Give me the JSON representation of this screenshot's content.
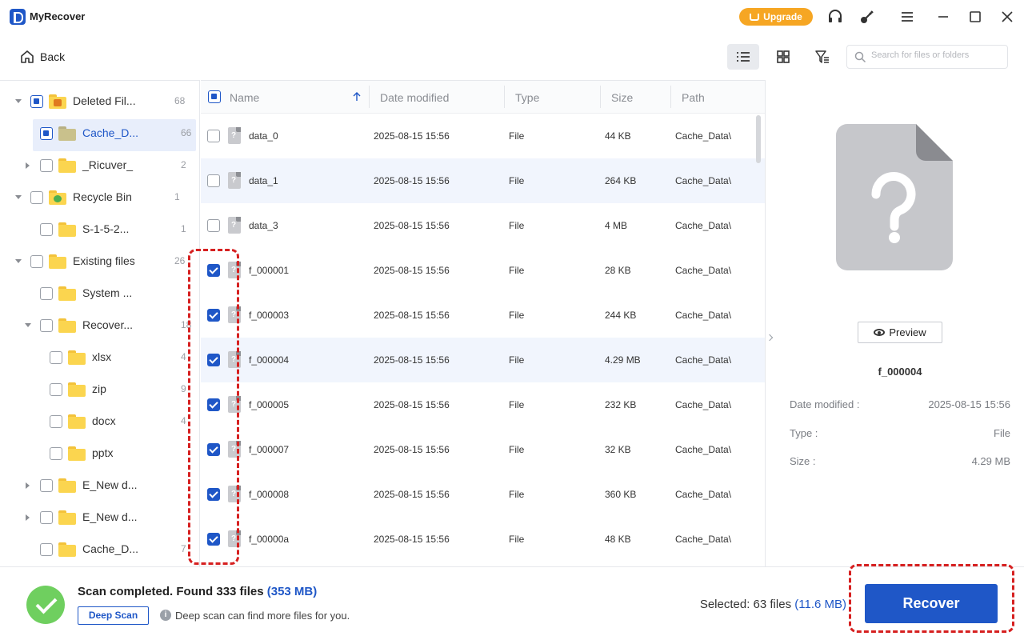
{
  "app": {
    "title": "MyRecover",
    "upgrade_label": "Upgrade"
  },
  "toolbar": {
    "back_label": "Back",
    "search_placeholder": "Search for files or folders"
  },
  "tree": [
    {
      "label": "Deleted Fil...",
      "count": "68",
      "level": 0,
      "arrow": "down",
      "check": "partial",
      "icon": "trash"
    },
    {
      "label": "Cache_D...",
      "count": "66",
      "level": 1,
      "arrow": "",
      "check": "partial",
      "icon": "folder",
      "selected": true
    },
    {
      "label": "_Ricuver_",
      "count": "2",
      "level": 1,
      "arrow": "right",
      "check": "none",
      "icon": "folder"
    },
    {
      "label": "Recycle Bin",
      "count": "1",
      "level": 0,
      "arrow": "down",
      "check": "none",
      "icon": "recycle"
    },
    {
      "label": "S-1-5-2...",
      "count": "1",
      "level": 1,
      "arrow": "",
      "check": "none",
      "icon": "folder"
    },
    {
      "label": "Existing files",
      "count": "26",
      "level": 0,
      "arrow": "down",
      "check": "none",
      "icon": "folder"
    },
    {
      "label": "System ...",
      "count": "",
      "level": 1,
      "arrow": "",
      "check": "none",
      "icon": "folder"
    },
    {
      "label": "Recover...",
      "count": "18",
      "level": 1,
      "arrow": "down",
      "check": "none",
      "icon": "folder"
    },
    {
      "label": "xlsx",
      "count": "4",
      "level": 2,
      "arrow": "",
      "check": "none",
      "icon": "folder"
    },
    {
      "label": "zip",
      "count": "9",
      "level": 2,
      "arrow": "",
      "check": "none",
      "icon": "folder"
    },
    {
      "label": "docx",
      "count": "4",
      "level": 2,
      "arrow": "",
      "check": "none",
      "icon": "folder"
    },
    {
      "label": "pptx",
      "count": "",
      "level": 2,
      "arrow": "",
      "check": "none",
      "icon": "folder"
    },
    {
      "label": "E_New d...",
      "count": "",
      "level": 1,
      "arrow": "right",
      "check": "none",
      "icon": "folder"
    },
    {
      "label": "E_New d...",
      "count": "",
      "level": 1,
      "arrow": "right",
      "check": "none",
      "icon": "folder"
    },
    {
      "label": "Cache_D...",
      "count": "7",
      "level": 1,
      "arrow": "",
      "check": "none",
      "icon": "folder"
    }
  ],
  "columns": {
    "name": "Name",
    "date": "Date modified",
    "type": "Type",
    "size": "Size",
    "path": "Path"
  },
  "files": [
    {
      "name": "data_0",
      "date": "2025-08-15 15:56",
      "type": "File",
      "size": "44 KB",
      "path": "Cache_Data\\",
      "checked": false
    },
    {
      "name": "data_1",
      "date": "2025-08-15 15:56",
      "type": "File",
      "size": "264 KB",
      "path": "Cache_Data\\",
      "checked": false,
      "hover": true
    },
    {
      "name": "data_3",
      "date": "2025-08-15 15:56",
      "type": "File",
      "size": "4 MB",
      "path": "Cache_Data\\",
      "checked": false
    },
    {
      "name": "f_000001",
      "date": "2025-08-15 15:56",
      "type": "File",
      "size": "28 KB",
      "path": "Cache_Data\\",
      "checked": true
    },
    {
      "name": "f_000003",
      "date": "2025-08-15 15:56",
      "type": "File",
      "size": "244 KB",
      "path": "Cache_Data\\",
      "checked": true
    },
    {
      "name": "f_000004",
      "date": "2025-08-15 15:56",
      "type": "File",
      "size": "4.29 MB",
      "path": "Cache_Data\\",
      "checked": true,
      "hover": true
    },
    {
      "name": "f_000005",
      "date": "2025-08-15 15:56",
      "type": "File",
      "size": "232 KB",
      "path": "Cache_Data\\",
      "checked": true
    },
    {
      "name": "f_000007",
      "date": "2025-08-15 15:56",
      "type": "File",
      "size": "32 KB",
      "path": "Cache_Data\\",
      "checked": true
    },
    {
      "name": "f_000008",
      "date": "2025-08-15 15:56",
      "type": "File",
      "size": "360 KB",
      "path": "Cache_Data\\",
      "checked": true
    },
    {
      "name": "f_00000a",
      "date": "2025-08-15 15:56",
      "type": "File",
      "size": "48 KB",
      "path": "Cache_Data\\",
      "checked": true
    }
  ],
  "details": {
    "preview_label": "Preview",
    "filename": "f_000004",
    "date_label": "Date modified :",
    "date_value": "2025-08-15 15:56",
    "type_label": "Type :",
    "type_value": "File",
    "size_label": "Size :",
    "size_value": "4.29 MB"
  },
  "status": {
    "scan_text": "Scan completed. Found 333 files",
    "scan_size": "(353 MB)",
    "deep_scan_label": "Deep Scan",
    "deep_hint": "Deep scan can find more files for you.",
    "selected_text": "Selected: 63 files",
    "selected_size": "(11.6 MB)",
    "recover_label": "Recover"
  },
  "colors": {
    "accent": "#1f57c7",
    "upgrade": "#f6a623",
    "success": "#6fcf5f",
    "annotation": "#d62020"
  }
}
